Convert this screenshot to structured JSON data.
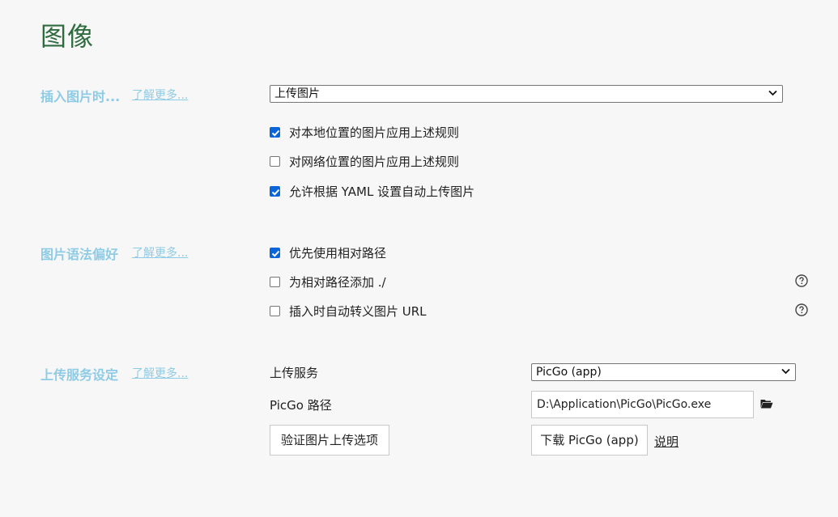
{
  "page": {
    "title": "图像"
  },
  "insert_image": {
    "label": "插入图片时...",
    "learn_more": "了解更多...",
    "action_select": "上传图片",
    "options": [
      {
        "label": "对本地位置的图片应用上述规则",
        "checked": true
      },
      {
        "label": "对网络位置的图片应用上述规则",
        "checked": false
      },
      {
        "label": "允许根据 YAML 设置自动上传图片",
        "checked": true
      }
    ]
  },
  "syntax_pref": {
    "label": "图片语法偏好",
    "learn_more": "了解更多...",
    "options": [
      {
        "label": "优先使用相对路径",
        "checked": true
      },
      {
        "label": "为相对路径添加 ./",
        "checked": false,
        "help_icon": "question-circle-icon"
      },
      {
        "label": "插入时自动转义图片 URL",
        "checked": false,
        "help_icon": "question-circle-icon"
      }
    ]
  },
  "upload_service": {
    "label": "上传服务设定",
    "learn_more": "了解更多...",
    "service_label": "上传服务",
    "service_value": "PicGo (app)",
    "path_label": "PicGo 路径",
    "path_value": "D:\\Application\\PicGo\\PicGo.exe",
    "folder_icon": "folder-open-icon",
    "verify_button": "验证图片上传选项",
    "download_button": "下载 PicGo (app)",
    "help_link": "说明"
  },
  "colors": {
    "title": "#2e6b3f",
    "section_label": "#8ecbe6",
    "checkbox_checked": "#0a66d8",
    "background": "#f7f7f7"
  }
}
